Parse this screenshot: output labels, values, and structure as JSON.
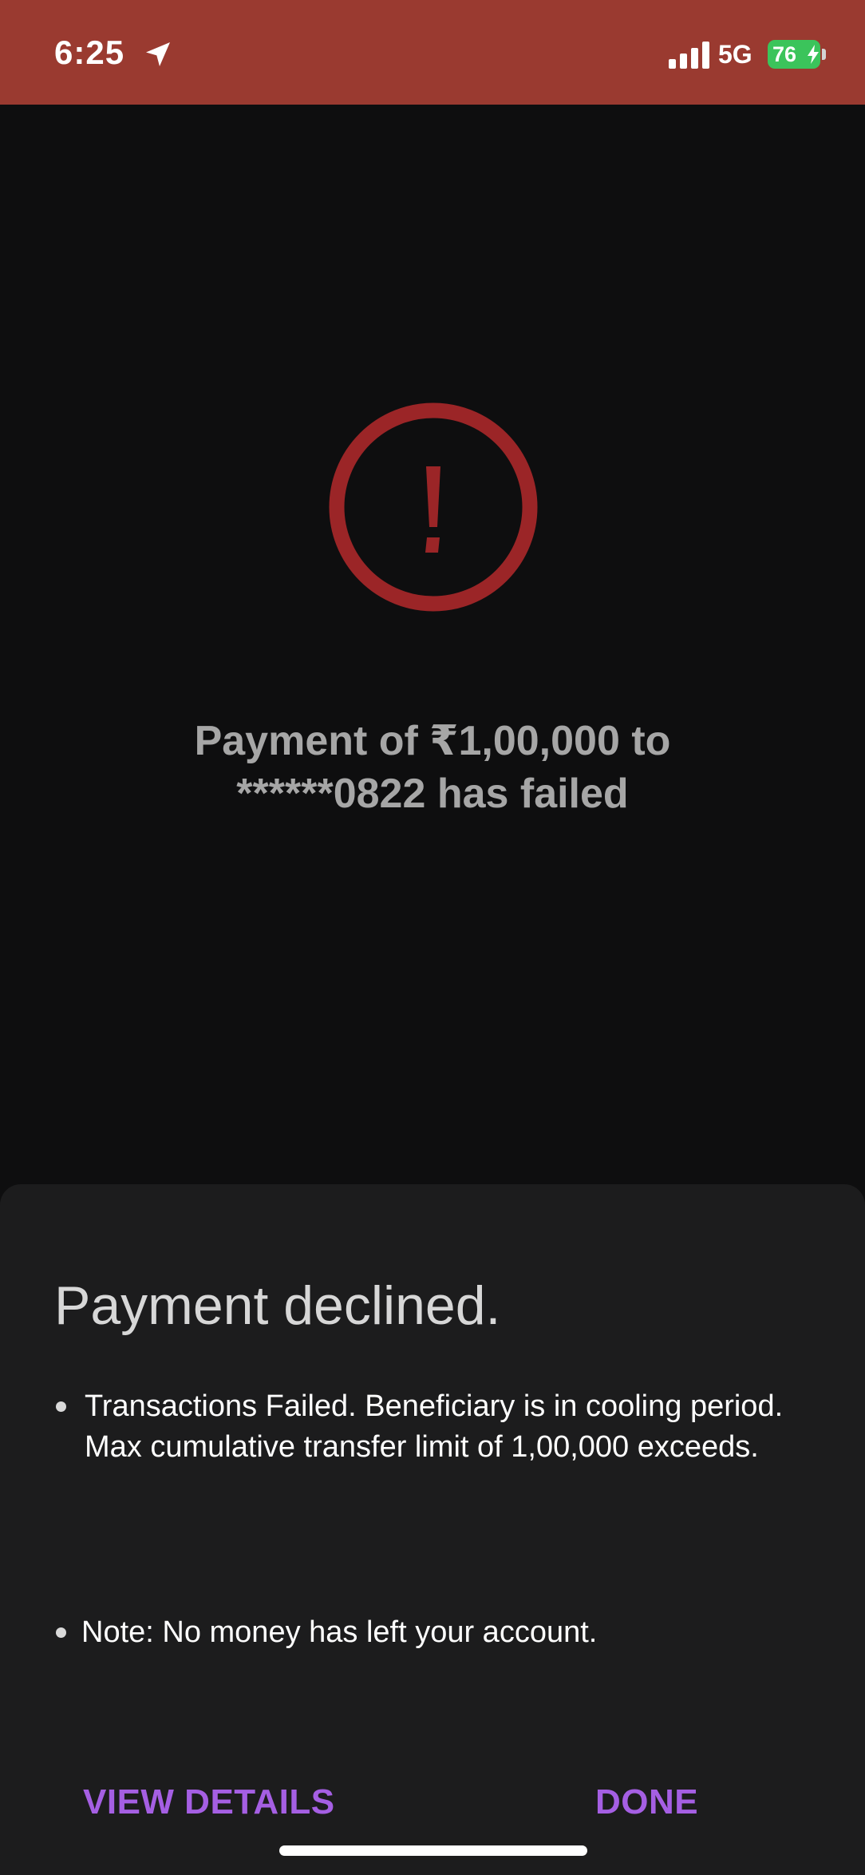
{
  "status_bar": {
    "time": "6:25",
    "network": "5G",
    "battery": "76",
    "background_color": "#9a3a30",
    "icons": [
      "location-arrow-icon",
      "cellular-signal-icon",
      "battery-charging-icon"
    ]
  },
  "error": {
    "icon": "exclamation-circle-icon",
    "icon_color": "#9b2527",
    "message_line1": "Payment of ₹1,00,000 to",
    "message_line2": "******0822 has failed"
  },
  "sheet": {
    "title": "Payment declined.",
    "bullets": [
      "Transactions Failed. Beneficiary is in cooling period. Max cumulative transfer limit of 1,00,000 exceeds.",
      "Note: No money has left your account."
    ],
    "actions": {
      "view_details": "VIEW DETAILS",
      "done": "DONE"
    },
    "action_color": "#a55fe3"
  }
}
